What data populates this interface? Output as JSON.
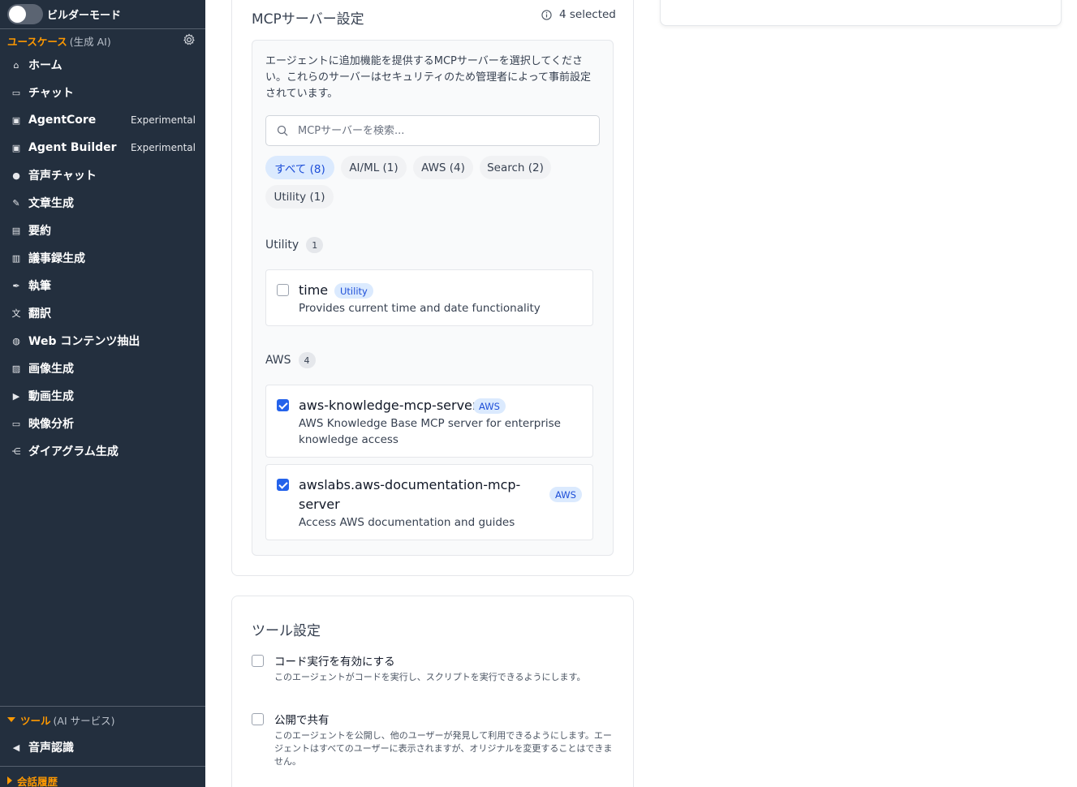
{
  "sidebar": {
    "builder_mode_label": "ビルダーモード",
    "usecase_section": {
      "title": "ユースケース",
      "subtitle": "(生成 AI)"
    },
    "items": [
      {
        "label": "ホーム",
        "icon": "home-icon",
        "tag": ""
      },
      {
        "label": "チャット",
        "icon": "chat-icon",
        "tag": ""
      },
      {
        "label": "AgentCore",
        "icon": "robot-icon",
        "tag": "Experimental"
      },
      {
        "label": "Agent Builder",
        "icon": "robot-icon",
        "tag": "Experimental"
      },
      {
        "label": "音声チャット",
        "icon": "microphone-icon",
        "tag": ""
      },
      {
        "label": "文章生成",
        "icon": "pencil-icon",
        "tag": ""
      },
      {
        "label": "要約",
        "icon": "summary-icon",
        "tag": ""
      },
      {
        "label": "議事録生成",
        "icon": "minutes-icon",
        "tag": ""
      },
      {
        "label": "執筆",
        "icon": "pen-icon",
        "tag": ""
      },
      {
        "label": "翻訳",
        "icon": "translate-icon",
        "tag": ""
      },
      {
        "label": "Web コンテンツ抽出",
        "icon": "globe-icon",
        "tag": ""
      },
      {
        "label": "画像生成",
        "icon": "image-icon",
        "tag": ""
      },
      {
        "label": "動画生成",
        "icon": "video-icon",
        "tag": ""
      },
      {
        "label": "映像分析",
        "icon": "camera-icon",
        "tag": ""
      },
      {
        "label": "ダイアグラム生成",
        "icon": "diagram-icon",
        "tag": ""
      }
    ],
    "tools_section": {
      "title": "ツール",
      "subtitle": "(AI サービス)"
    },
    "tools_items": [
      {
        "label": "音声認識",
        "icon": "speaker-icon"
      }
    ],
    "history_section": {
      "title": "会話履歴"
    }
  },
  "mcp": {
    "title": "MCPサーバー設定",
    "selected_text": "4 selected",
    "description": "エージェントに追加機能を提供するMCPサーバーを選択してください。これらのサーバーはセキュリティのため管理者によって事前設定されています。",
    "search_placeholder": "MCPサーバーを検索...",
    "filters": [
      "すべて (8)",
      "AI/ML (1)",
      "AWS (4)",
      "Search (2)",
      "Utility (1)"
    ],
    "groups": [
      {
        "name": "Utility",
        "count": "1",
        "servers": [
          {
            "name": "time",
            "badge": "Utility",
            "description": "Provides current time and date functionality",
            "checked": false
          }
        ]
      },
      {
        "name": "AWS",
        "count": "4",
        "servers": [
          {
            "name": "aws-knowledge-mcp-server",
            "badge": "AWS",
            "description": "AWS Knowledge Base MCP server for enterprise knowledge access",
            "checked": true
          },
          {
            "name": "awslabs.aws-documentation-mcp-server",
            "badge": "AWS",
            "description": "Access AWS documentation and guides",
            "checked": true
          }
        ]
      }
    ]
  },
  "tools": {
    "title": "ツール設定",
    "options": [
      {
        "label": "コード実行を有効にする",
        "description": "このエージェントがコードを実行し、スクリプトを実行できるようにします。",
        "checked": false
      },
      {
        "label": "公開で共有",
        "description": "このエージェントを公開し、他のユーザーが発見して利用できるようにします。エージェントはすべてのユーザーに表示されますが、オリジナルを変更することはできません。",
        "checked": false
      }
    ]
  },
  "colors": {
    "sidebar_bg": "#232f3e",
    "accent_orange": "#ff9900",
    "primary_blue": "#2563eb",
    "badge_bg": "#dbeafe"
  }
}
